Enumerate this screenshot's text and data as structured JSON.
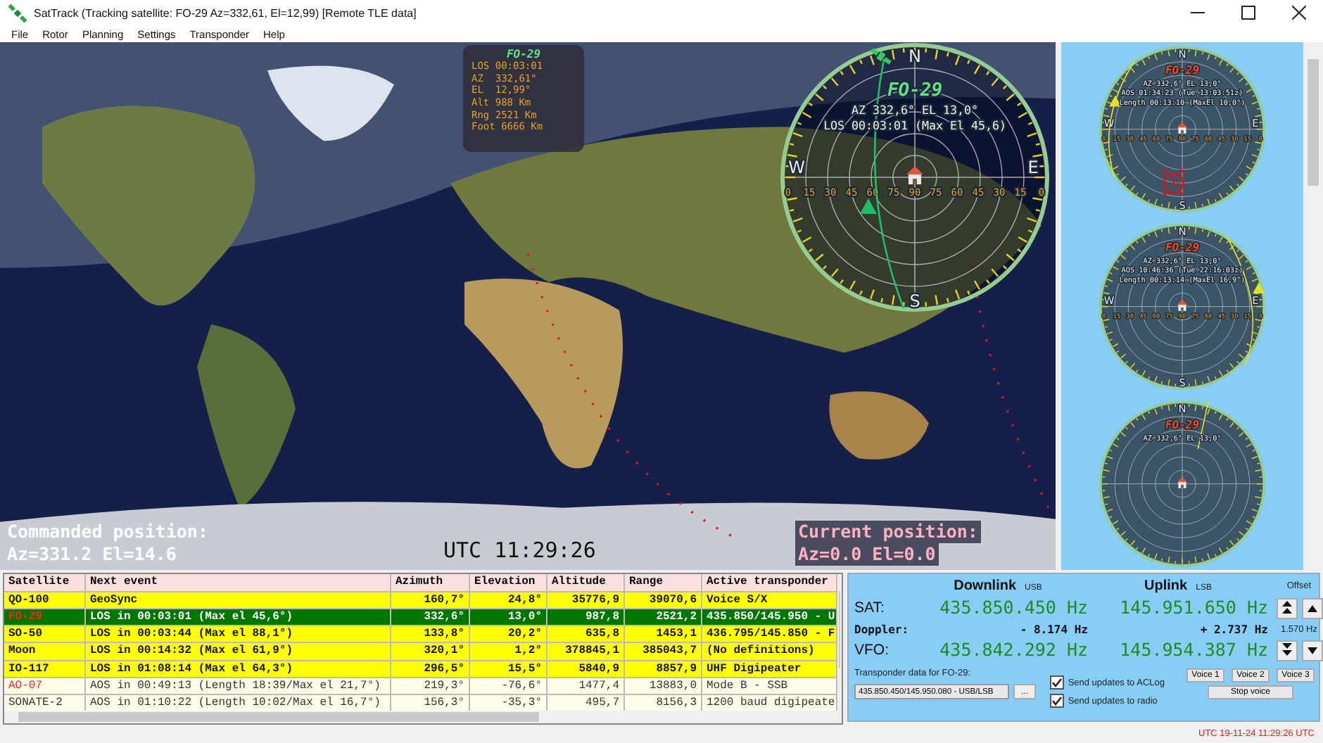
{
  "window": {
    "title": "SatTrack (Tracking satellite: FO-29 Az=332,61, El=12,99) [Remote TLE data]"
  },
  "menu": [
    "File",
    "Rotor",
    "Planning",
    "Settings",
    "Transponder",
    "Help"
  ],
  "map": {
    "popup": {
      "title": "FO-29",
      "lines": [
        "LOS 00:03:01",
        "AZ  332,61°",
        "EL  12,99°",
        "Alt 988 Km",
        "Rng 2521 Km",
        "Foot 6666 Km"
      ]
    },
    "commanded": [
      "Commanded position:",
      "Az=331.2 El=14.6"
    ],
    "clock": "UTC 11:29:26",
    "current": [
      "Current position:",
      "Az=0.0 El=0.0"
    ]
  },
  "main_plot": {
    "kind": "live",
    "title": "FO-29",
    "lines": [
      "AZ 332,6° EL 13,0°",
      "LOS 00:03:01 (Max El 45,6)"
    ],
    "compass": [
      "N",
      "E",
      "S",
      "W"
    ],
    "scale": [
      "0",
      "15",
      "30",
      "45",
      "60",
      "75",
      "90",
      "75",
      "60",
      "45",
      "30",
      "15",
      "0"
    ]
  },
  "pass_plots": [
    {
      "kind": "upcoming",
      "title": "FO-29",
      "lines": [
        "AZ 332,6° EL 13,0°",
        "AOS 01:34:23 (Tue 13:03:51z)",
        "Length 00:13:10 (MaxEl 10,0°)"
      ],
      "compass": [
        "N",
        "E",
        "S",
        "W"
      ],
      "scale": [
        "0",
        "15",
        "30",
        "45",
        "60",
        "75",
        "90",
        "75",
        "60",
        "45",
        "30",
        "15",
        "0"
      ],
      "alarm": true
    },
    {
      "kind": "upcoming",
      "title": "FO-29",
      "lines": [
        "AZ 332,6° EL 13,0°",
        "AOS 10:46:36 (Tue 22:16:03z)",
        "Length 00:13:14 (MaxEl 16,9°)"
      ],
      "compass": [
        "N",
        "E",
        "S",
        "W"
      ],
      "scale": [
        "0",
        "15",
        "30",
        "45",
        "60",
        "75",
        "90",
        "75",
        "60",
        "45",
        "30",
        "15",
        "0"
      ],
      "alarm": false
    },
    {
      "kind": "upcoming",
      "title": "FO-29",
      "lines": [
        "AZ 332,6° EL 13,0°"
      ],
      "compass": [
        "N"
      ]
    }
  ],
  "table": {
    "columns": [
      "Satellite",
      "Next event",
      "Azimuth",
      "Elevation",
      "Altitude",
      "Range",
      "Active transponder"
    ],
    "rows": [
      {
        "selected": false,
        "above_horizon": true,
        "alert": false,
        "cells": [
          "QO-100",
          "GeoSync",
          "160,7°",
          "24,8°",
          "35776,9",
          "39070,6",
          "Voice S/X"
        ]
      },
      {
        "selected": true,
        "above_horizon": true,
        "alert": true,
        "cells": [
          "FO-29",
          "LOS in 00:03:01 (Max el 45,6°)",
          "332,6°",
          "13,0°",
          "987,8",
          "2521,2",
          "435.850/145.950 - U"
        ]
      },
      {
        "selected": false,
        "above_horizon": true,
        "alert": false,
        "cells": [
          "SO-50",
          "LOS in 00:03:44 (Max el 88,1°)",
          "133,8°",
          "20,2°",
          "635,8",
          "1453,1",
          "436.795/145.850 - F"
        ]
      },
      {
        "selected": false,
        "above_horizon": true,
        "alert": false,
        "cells": [
          "Moon",
          "LOS in 00:14:32 (Max el 61,9°)",
          "320,1°",
          "1,2°",
          "378845,1",
          "385043,7",
          "(No definitions)"
        ]
      },
      {
        "selected": false,
        "above_horizon": true,
        "alert": false,
        "cells": [
          "IO-117",
          "LOS in 01:08:14 (Max el 64,3°)",
          "296,5°",
          "15,5°",
          "5840,9",
          "8857,9",
          "UHF Digipeater"
        ]
      },
      {
        "selected": false,
        "above_horizon": false,
        "alert": true,
        "cells": [
          "AO-07",
          "AOS in 00:49:13 (Length 18:39/Max el 21,7°)",
          "219,3°",
          "-76,6°",
          "1477,4",
          "13883,0",
          "Mode B - SSB"
        ]
      },
      {
        "selected": false,
        "above_horizon": false,
        "alert": false,
        "cells": [
          "SONATE-2",
          "AOS in 01:10:22 (Length 10:02/Max el 16,7°)",
          "156,3°",
          "-35,3°",
          "495,7",
          "8156,3",
          "1200 baud digipeate"
        ]
      }
    ]
  },
  "radio": {
    "downlink": {
      "title": "Downlink",
      "mode": "USB",
      "sat": "435.850.450 Hz",
      "doppler": "- 8.174 Hz",
      "vfo": "435.842.292 Hz"
    },
    "uplink": {
      "title": "Uplink",
      "mode": "LSB",
      "sat": "145.951.650 Hz",
      "doppler": "+ 2.737 Hz",
      "vfo": "145.954.387 Hz"
    },
    "labels": [
      "SAT:",
      "Doppler:",
      "VFO:"
    ],
    "offset_title": "Offset",
    "offset_value": "1.570 Hz",
    "transponder_label": "Transponder data for FO-29:",
    "transponder_value": "435.850.450/145.950.080 - USB/LSB",
    "browse_button": "...",
    "checks": [
      {
        "label": "Send updates to ACLog",
        "checked": true
      },
      {
        "label": "Send updates to radio",
        "checked": true
      }
    ],
    "voice_buttons": [
      "Voice 1",
      "Voice 2",
      "Voice 3"
    ],
    "stop_button": "Stop voice"
  },
  "status_bar": {
    "clock": "UTC 19-11-24 11:29:26 UTC"
  }
}
